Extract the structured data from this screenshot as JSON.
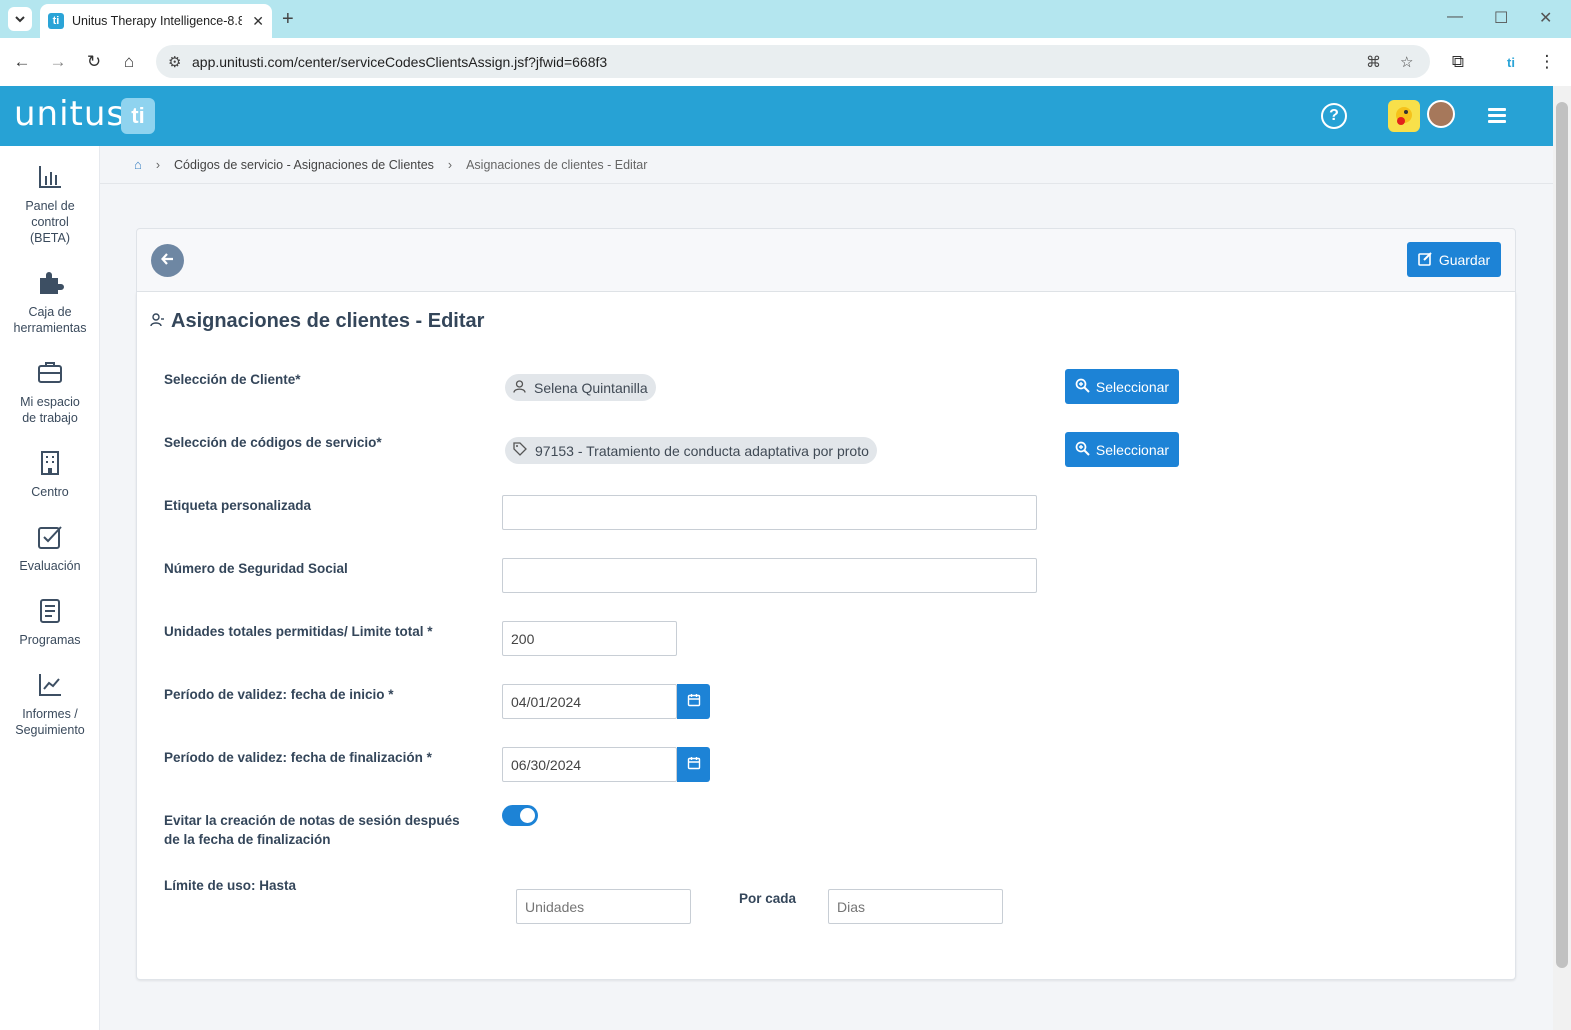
{
  "browser": {
    "tab_title": "Unitus Therapy Intelligence-8.8",
    "favicon_letter": "ti",
    "url": "app.unitusti.com/center/serviceCodesClientsAssign.jsf?jfwid=668f3",
    "icons": [
      "tab-list-icon",
      "close-tab-icon",
      "new-tab-icon",
      "minimize-icon",
      "maximize-icon",
      "close-window-icon",
      "back-icon",
      "forward-icon",
      "reload-icon",
      "home-icon",
      "site-info-icon",
      "translate-icon",
      "bookmark-star-icon",
      "extensions-icon",
      "extension-unitus-icon",
      "more-options-icon"
    ]
  },
  "header": {
    "logo_text": "unitus",
    "logo_mark": "ti",
    "brand_color": "#27a2d5",
    "icons": [
      "help-icon",
      "center-logo-icon",
      "user-avatar",
      "menu-icon"
    ]
  },
  "sidebar": {
    "items": [
      {
        "label_line1": "Panel de",
        "label_line2": "control",
        "label_line3": "(BETA)",
        "icon": "bar-chart-icon"
      },
      {
        "label_line1": "Caja de",
        "label_line2": "herramientas",
        "icon": "puzzle-icon"
      },
      {
        "label_line1": "Mi espacio",
        "label_line2": "de trabajo",
        "icon": "briefcase-icon"
      },
      {
        "label_line1": "Centro",
        "icon": "building-icon"
      },
      {
        "label_line1": "Evaluación",
        "icon": "checkbox-icon"
      },
      {
        "label_line1": "Programas",
        "icon": "document-icon"
      },
      {
        "label_line1": "Informes /",
        "label_line2": "Seguimiento",
        "icon": "trend-chart-icon"
      }
    ]
  },
  "breadcrumb": {
    "home_icon": "home-icon",
    "item1": "Códigos de servicio - Asignaciones de Clientes",
    "item2": "Asignaciones de clientes - Editar"
  },
  "actions": {
    "back_icon": "arrow-left-icon",
    "save_label": "Guardar",
    "save_icon": "edit-icon"
  },
  "form": {
    "title": "Asignaciones de clientes - Editar",
    "title_icon": "user-settings-icon",
    "client_label": "Selección de Cliente*",
    "client_value": "Selena Quintanilla",
    "client_icon": "user-icon",
    "select_label": "Seleccionar",
    "select_icon": "zoom-in-icon",
    "service_label": "Selección de códigos de servicio*",
    "service_value": "97153 - Tratamiento de conducta adaptativa por proto",
    "service_icon": "tag-icon",
    "custom_label": "Etiqueta personalizada",
    "custom_value": "",
    "ssn_label": "Número de Seguridad Social",
    "ssn_value": "",
    "units_label": "Unidades totales permitidas/ Limite total  *",
    "units_value": "200",
    "start_label": "Período de validez: fecha de inicio  *",
    "start_value": "04/01/2024",
    "end_label": "Período de validez: fecha de finalización  *",
    "end_value": "06/30/2024",
    "calendar_icon": "calendar-icon",
    "prevent_label_line1": "Evitar la creación de notas de sesión después",
    "prevent_label_line2": "de la fecha de finalización",
    "prevent_enabled": true,
    "limit_label": "Límite de uso: Hasta",
    "limit_units_placeholder": "Unidades",
    "per_label": "Por cada",
    "limit_days_placeholder": "Dias"
  }
}
